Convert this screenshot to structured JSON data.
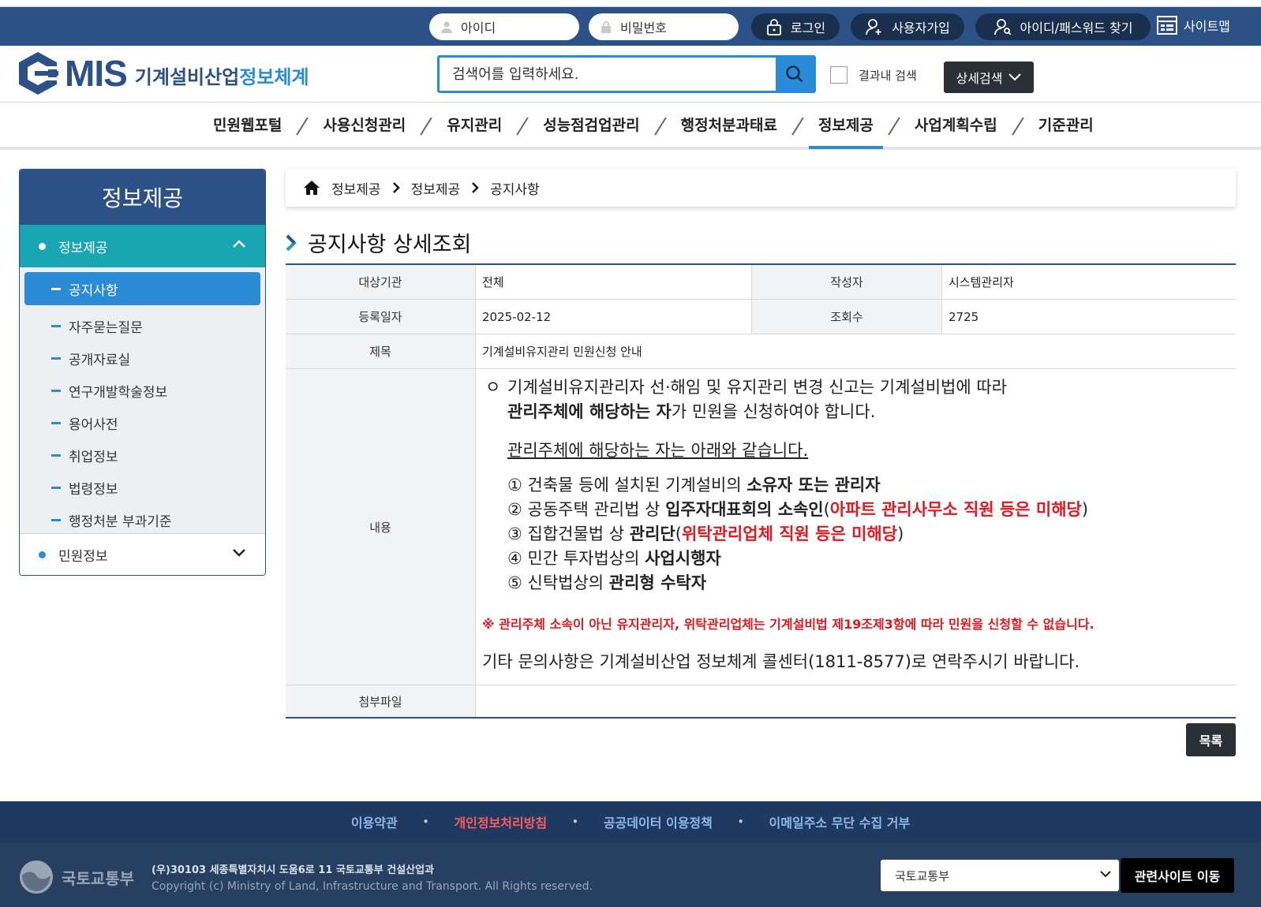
{
  "topbar": {
    "id_placeholder": "아이디",
    "pw_placeholder": "비밀번호",
    "login_label": "로그인",
    "signup_label": "사용자가입",
    "find_label": "아이디/패스워드 찾기",
    "sitemap_label": "사이트맵"
  },
  "header": {
    "logo_main": "MIS",
    "logo_sub_a": "기계설비산업",
    "logo_sub_b": "정보체계",
    "search_placeholder": "검색어를 입력하세요.",
    "in_result_label": "결과내 검색",
    "detail_search_label": "상세검색"
  },
  "gnb": {
    "items": [
      "민원웹포털",
      "사용신청관리",
      "유지관리",
      "성능점검업관리",
      "행정처분과태료",
      "정보제공",
      "사업계획수립",
      "기준관리"
    ],
    "active": "정보제공"
  },
  "lnb": {
    "title": "정보제공",
    "group1": "정보제공",
    "items": [
      "공지사항",
      "자주묻는질문",
      "공개자료실",
      "연구개발학술정보",
      "용어사전",
      "취업정보",
      "법령정보",
      "행정처분 부과기준"
    ],
    "active": "공지사항",
    "group2": "민원정보"
  },
  "breadcrumb": [
    "정보제공",
    "정보제공",
    "공지사항"
  ],
  "page_title": "공지사항 상세조회",
  "detail": {
    "target_label": "대상기관",
    "target_value": "전체",
    "author_label": "작성자",
    "author_value": "시스템관리자",
    "date_label": "등록일자",
    "date_value": "2025-02-12",
    "views_label": "조회수",
    "views_value": "2725",
    "subject_label": "제목",
    "subject_value": "기계설비유지관리 민원신청 안내",
    "content_label": "내용",
    "attach_label": "첨부파일"
  },
  "content": {
    "bullet": "ㅇ",
    "l1": "기계설비유지관리자 선·해임 및 유지관리 변경 신고는 기계설비법에 따라",
    "l2_bold": "관리주체에 해당하는 자",
    "l2_rest": "가 민원을 신청하여야 합니다.",
    "l3": "관리주체에 해당하는 자는 아래와 같습니다.",
    "i1_num": "①",
    "i1_a": "건축물 등에 설치된 기계설비의 ",
    "i1_b": "소유자 또는 관리자",
    "i2_num": "②",
    "i2_a": "공동주택 관리법 상 ",
    "i2_b": "입주자대표회의 소속인",
    "i2_c": "(",
    "i2_d": "아파트 관리사무소 직원 등은 미해당",
    "i2_e": ")",
    "i3_num": "③",
    "i3_a": "집합건물법 상 ",
    "i3_b": "관리단",
    "i3_c": "(",
    "i3_d": "위탁관리업체 직원 등은 미해당",
    "i3_e": ")",
    "i4_num": "④",
    "i4_a": "민간 투자법상의 ",
    "i4_b": "사업시행자",
    "i5_num": "⑤",
    "i5_a": "신탁법상의 ",
    "i5_b": "관리형 수탁자",
    "warn": "※ 관리주체 소속이 아닌 유지관리자, 위탁관리업체는 기계설비법 제19조제3항에 따라 민원을 신청할 수 없습니다.",
    "contact": "기타 문의사항은 기계설비산업 정보체계 콜센터(1811-8577)로 연락주시기 바랍니다."
  },
  "list_button": "목록",
  "footer": {
    "links": [
      "이용약관",
      "개인정보처리방침",
      "공공데이터 이용정책",
      "이메일주소 무단 수집 거부"
    ],
    "sep": "•",
    "ministry": "국토교통부",
    "address": "(우)30103 세종특별자치시 도움6로 11 국토교통부 건설산업과",
    "copyright": "Copyright (c) Ministry of Land, Infrastructure and Transport. All Rights reserved.",
    "select_value": "국토교통부",
    "go_label": "관련사이트 이동"
  },
  "colors": {
    "navy": "#2c5187",
    "blue": "#2a8bd6",
    "teal": "#1aa5b3",
    "red": "#e3171d"
  }
}
